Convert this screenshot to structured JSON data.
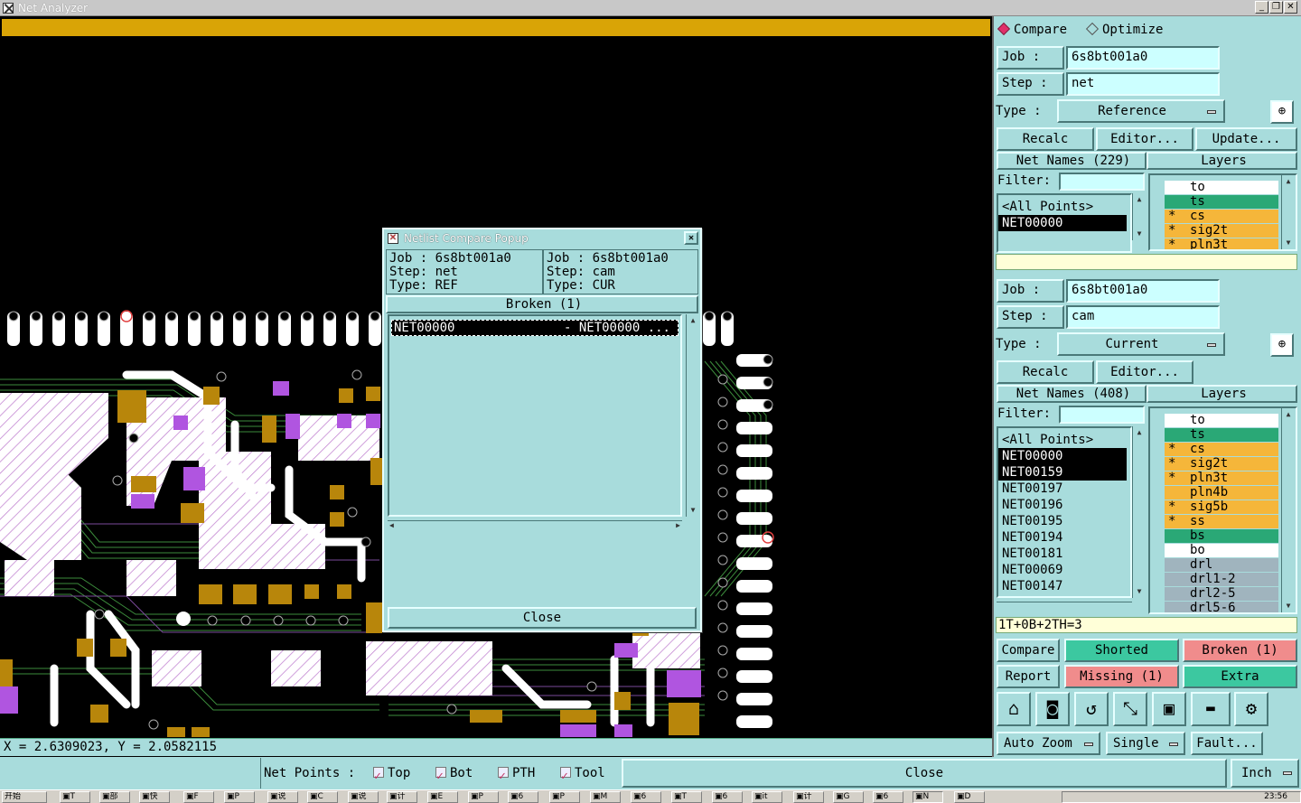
{
  "window": {
    "title": "Net Analyzer"
  },
  "coords": "X = 2.6309023, Y = 2.0582115",
  "bottombar": {
    "net_points_label": "Net Points :",
    "checks": [
      "Top",
      "Bot",
      "PTH",
      "Tool"
    ],
    "close_label": "Close",
    "units": "Inch"
  },
  "popup": {
    "title": "Netlist Compare Popup",
    "left": {
      "job": "Job  : 6s8bt001a0",
      "step": "Step: net",
      "type": "Type: REF"
    },
    "right": {
      "job": "Job  : 6s8bt001a0",
      "step": "Step: cam",
      "type": "Type: CUR"
    },
    "header": "Broken (1)",
    "rows": [
      {
        "left": "NET00000",
        "right": "- NET00000 ..."
      }
    ],
    "close_label": "Close"
  },
  "panel": {
    "mode": {
      "compare": "Compare",
      "optimize": "Optimize"
    },
    "labels": {
      "job": "Job  :",
      "step": "Step :",
      "type": "Type :",
      "filter": "Filter:"
    },
    "ref": {
      "job": "6s8bt001a0",
      "step": "net",
      "type": "Reference",
      "buttons": {
        "recalc": "Recalc",
        "editor": "Editor...",
        "update": "Update..."
      },
      "net_names": "Net Names (229)",
      "layers_label": "Layers",
      "nets": [
        "<All Points>",
        "NET00000"
      ],
      "layers": [
        {
          "name": "to",
          "star": "",
          "color": "#ffffff"
        },
        {
          "name": "ts",
          "star": "",
          "color": "#2aa876"
        },
        {
          "name": "cs",
          "star": "*",
          "color": "#f5b63a"
        },
        {
          "name": "sig2t",
          "star": "*",
          "color": "#f5b63a"
        },
        {
          "name": "pln3t",
          "star": "*",
          "color": "#f5b63a"
        }
      ]
    },
    "cur": {
      "job": "6s8bt001a0",
      "step": "cam",
      "type": "Current",
      "buttons": {
        "recalc": "Recalc",
        "editor": "Editor..."
      },
      "net_names": "Net Names (408)",
      "layers_label": "Layers",
      "nets": [
        "<All Points>",
        "NET00000",
        "NET00159",
        "NET00197",
        "NET00196",
        "NET00195",
        "NET00194",
        "NET00181",
        "NET00069",
        "NET00147"
      ],
      "layers": [
        {
          "name": "to",
          "star": "",
          "color": "#ffffff"
        },
        {
          "name": "ts",
          "star": "",
          "color": "#2aa876"
        },
        {
          "name": "cs",
          "star": "*",
          "color": "#f5b63a"
        },
        {
          "name": "sig2t",
          "star": "*",
          "color": "#f5b63a"
        },
        {
          "name": "pln3t",
          "star": "*",
          "color": "#f5b63a"
        },
        {
          "name": "pln4b",
          "star": "",
          "color": "#f5b63a"
        },
        {
          "name": "sig5b",
          "star": "*",
          "color": "#f5b63a"
        },
        {
          "name": "ss",
          "star": "*",
          "color": "#f5b63a"
        },
        {
          "name": "bs",
          "star": "",
          "color": "#2aa876"
        },
        {
          "name": "bo",
          "star": "",
          "color": "#ffffff"
        },
        {
          "name": "drl",
          "star": "",
          "color": "#a0b4be"
        },
        {
          "name": "drl1-2",
          "star": "",
          "color": "#a0b4be"
        },
        {
          "name": "drl2-5",
          "star": "",
          "color": "#a0b4be"
        },
        {
          "name": "drl5-6",
          "star": "",
          "color": "#a0b4be"
        }
      ],
      "status": "1T+0B+2TH=3"
    },
    "results": {
      "compare": "Compare",
      "shorted": "Shorted",
      "broken": "Broken (1)",
      "report": "Report",
      "missing": "Missing (1)",
      "extra": "Extra"
    },
    "colors": {
      "green": "#3cc8a0",
      "pink": "#f08c8c"
    },
    "tools": [
      "home-icon",
      "circle-select-icon",
      "undo-icon",
      "route-icon",
      "frame-icon",
      "ruler-icon",
      "settings-icon"
    ],
    "bottom": {
      "auto_zoom": "Auto Zoom",
      "single": "Single",
      "fault": "Fault..."
    }
  },
  "taskbar": {
    "start": "开始",
    "clock": "23:56"
  }
}
